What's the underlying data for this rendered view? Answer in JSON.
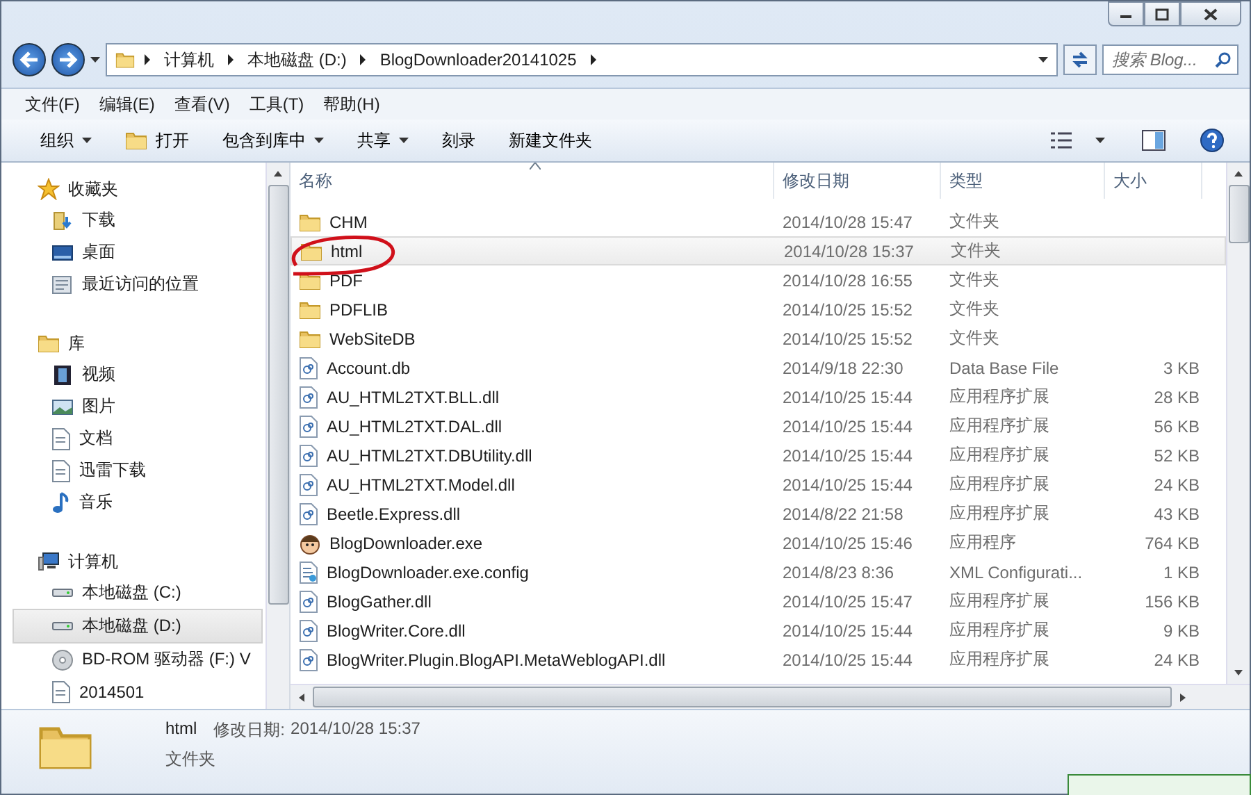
{
  "address_bar": {
    "crumbs": [
      "计算机",
      "本地磁盘 (D:)",
      "BlogDownloader20141025"
    ],
    "search_placeholder": "搜索 Blog..."
  },
  "menu": [
    "文件(F)",
    "编辑(E)",
    "查看(V)",
    "工具(T)",
    "帮助(H)"
  ],
  "toolbar": [
    {
      "label": "组织",
      "kind": "dropdown"
    },
    {
      "label": "打开",
      "kind": "open"
    },
    {
      "label": "包含到库中",
      "kind": "dropdown"
    },
    {
      "label": "共享",
      "kind": "dropdown"
    },
    {
      "label": "刻录",
      "kind": "plain"
    },
    {
      "label": "新建文件夹",
      "kind": "plain"
    }
  ],
  "sidebar": {
    "groups": [
      {
        "label": "收藏夹",
        "kind": "star",
        "children": [
          {
            "label": "下载",
            "kind": "download",
            "selected": false
          },
          {
            "label": "桌面",
            "kind": "desktop",
            "selected": false
          },
          {
            "label": "最近访问的位置",
            "kind": "recent",
            "selected": false
          }
        ]
      },
      {
        "label": "库",
        "kind": "library",
        "children": [
          {
            "label": "视频",
            "kind": "video",
            "selected": false
          },
          {
            "label": "图片",
            "kind": "picture",
            "selected": false
          },
          {
            "label": "文档",
            "kind": "doc",
            "selected": false
          },
          {
            "label": "迅雷下载",
            "kind": "doc",
            "selected": false
          },
          {
            "label": "音乐",
            "kind": "music",
            "selected": false
          }
        ]
      },
      {
        "label": "计算机",
        "kind": "computer",
        "children": [
          {
            "label": "本地磁盘 (C:)",
            "kind": "drive",
            "selected": false
          },
          {
            "label": "本地磁盘 (D:)",
            "kind": "drive",
            "selected": true
          },
          {
            "label": "BD-ROM 驱动器 (F:) V",
            "kind": "disc",
            "selected": false
          },
          {
            "label": "2014501",
            "kind": "doc",
            "selected": false
          }
        ]
      }
    ]
  },
  "table": {
    "columns": [
      "名称",
      "修改日期",
      "类型",
      "大小"
    ],
    "rows": [
      {
        "name": "CHM",
        "kind": "folder",
        "date": "2014/10/28 15:47",
        "type": "文件夹",
        "selected": false
      },
      {
        "name": "html",
        "kind": "folder",
        "date": "2014/10/28 15:37",
        "type": "文件夹",
        "selected": true
      },
      {
        "name": "PDF",
        "kind": "folder",
        "date": "2014/10/28 16:55",
        "type": "文件夹",
        "selected": false
      },
      {
        "name": "PDFLIB",
        "kind": "folder",
        "date": "2014/10/25 15:52",
        "type": "文件夹",
        "selected": false
      },
      {
        "name": "WebSiteDB",
        "kind": "folder",
        "date": "2014/10/25 15:52",
        "type": "文件夹",
        "selected": false
      },
      {
        "name": "Account.db",
        "kind": "file",
        "date": "2014/9/18 22:30",
        "type": "Data Base File",
        "size": "3 KB",
        "selected": false
      },
      {
        "name": "AU_HTML2TXT.BLL.dll",
        "kind": "file",
        "date": "2014/10/25 15:44",
        "type": "应用程序扩展",
        "size": "28 KB",
        "selected": false
      },
      {
        "name": "AU_HTML2TXT.DAL.dll",
        "kind": "file",
        "date": "2014/10/25 15:44",
        "type": "应用程序扩展",
        "size": "56 KB",
        "selected": false
      },
      {
        "name": "AU_HTML2TXT.DBUtility.dll",
        "kind": "file",
        "date": "2014/10/25 15:44",
        "type": "应用程序扩展",
        "size": "52 KB",
        "selected": false
      },
      {
        "name": "AU_HTML2TXT.Model.dll",
        "kind": "file",
        "date": "2014/10/25 15:44",
        "type": "应用程序扩展",
        "size": "24 KB",
        "selected": false
      },
      {
        "name": "Beetle.Express.dll",
        "kind": "file",
        "date": "2014/8/22 21:58",
        "type": "应用程序扩展",
        "size": "43 KB",
        "selected": false
      },
      {
        "name": "BlogDownloader.exe",
        "kind": "app",
        "date": "2014/10/25 15:46",
        "type": "应用程序",
        "size": "764 KB",
        "selected": false
      },
      {
        "name": "BlogDownloader.exe.config",
        "kind": "config",
        "date": "2014/8/23 8:36",
        "type": "XML Configurati...",
        "size": "1 KB",
        "selected": false
      },
      {
        "name": "BlogGather.dll",
        "kind": "file",
        "date": "2014/10/25 15:47",
        "type": "应用程序扩展",
        "size": "156 KB",
        "selected": false
      },
      {
        "name": "BlogWriter.Core.dll",
        "kind": "file",
        "date": "2014/10/25 15:44",
        "type": "应用程序扩展",
        "size": "9 KB",
        "selected": false
      },
      {
        "name": "BlogWriter.Plugin.BlogAPI.MetaWeblogAPI.dll",
        "kind": "file",
        "date": "2014/10/25 15:44",
        "type": "应用程序扩展",
        "size": "24 KB",
        "selected": false
      }
    ]
  },
  "details": {
    "name": "html",
    "date_label": "修改日期:",
    "date": "2014/10/28 15:37",
    "type": "文件夹"
  }
}
